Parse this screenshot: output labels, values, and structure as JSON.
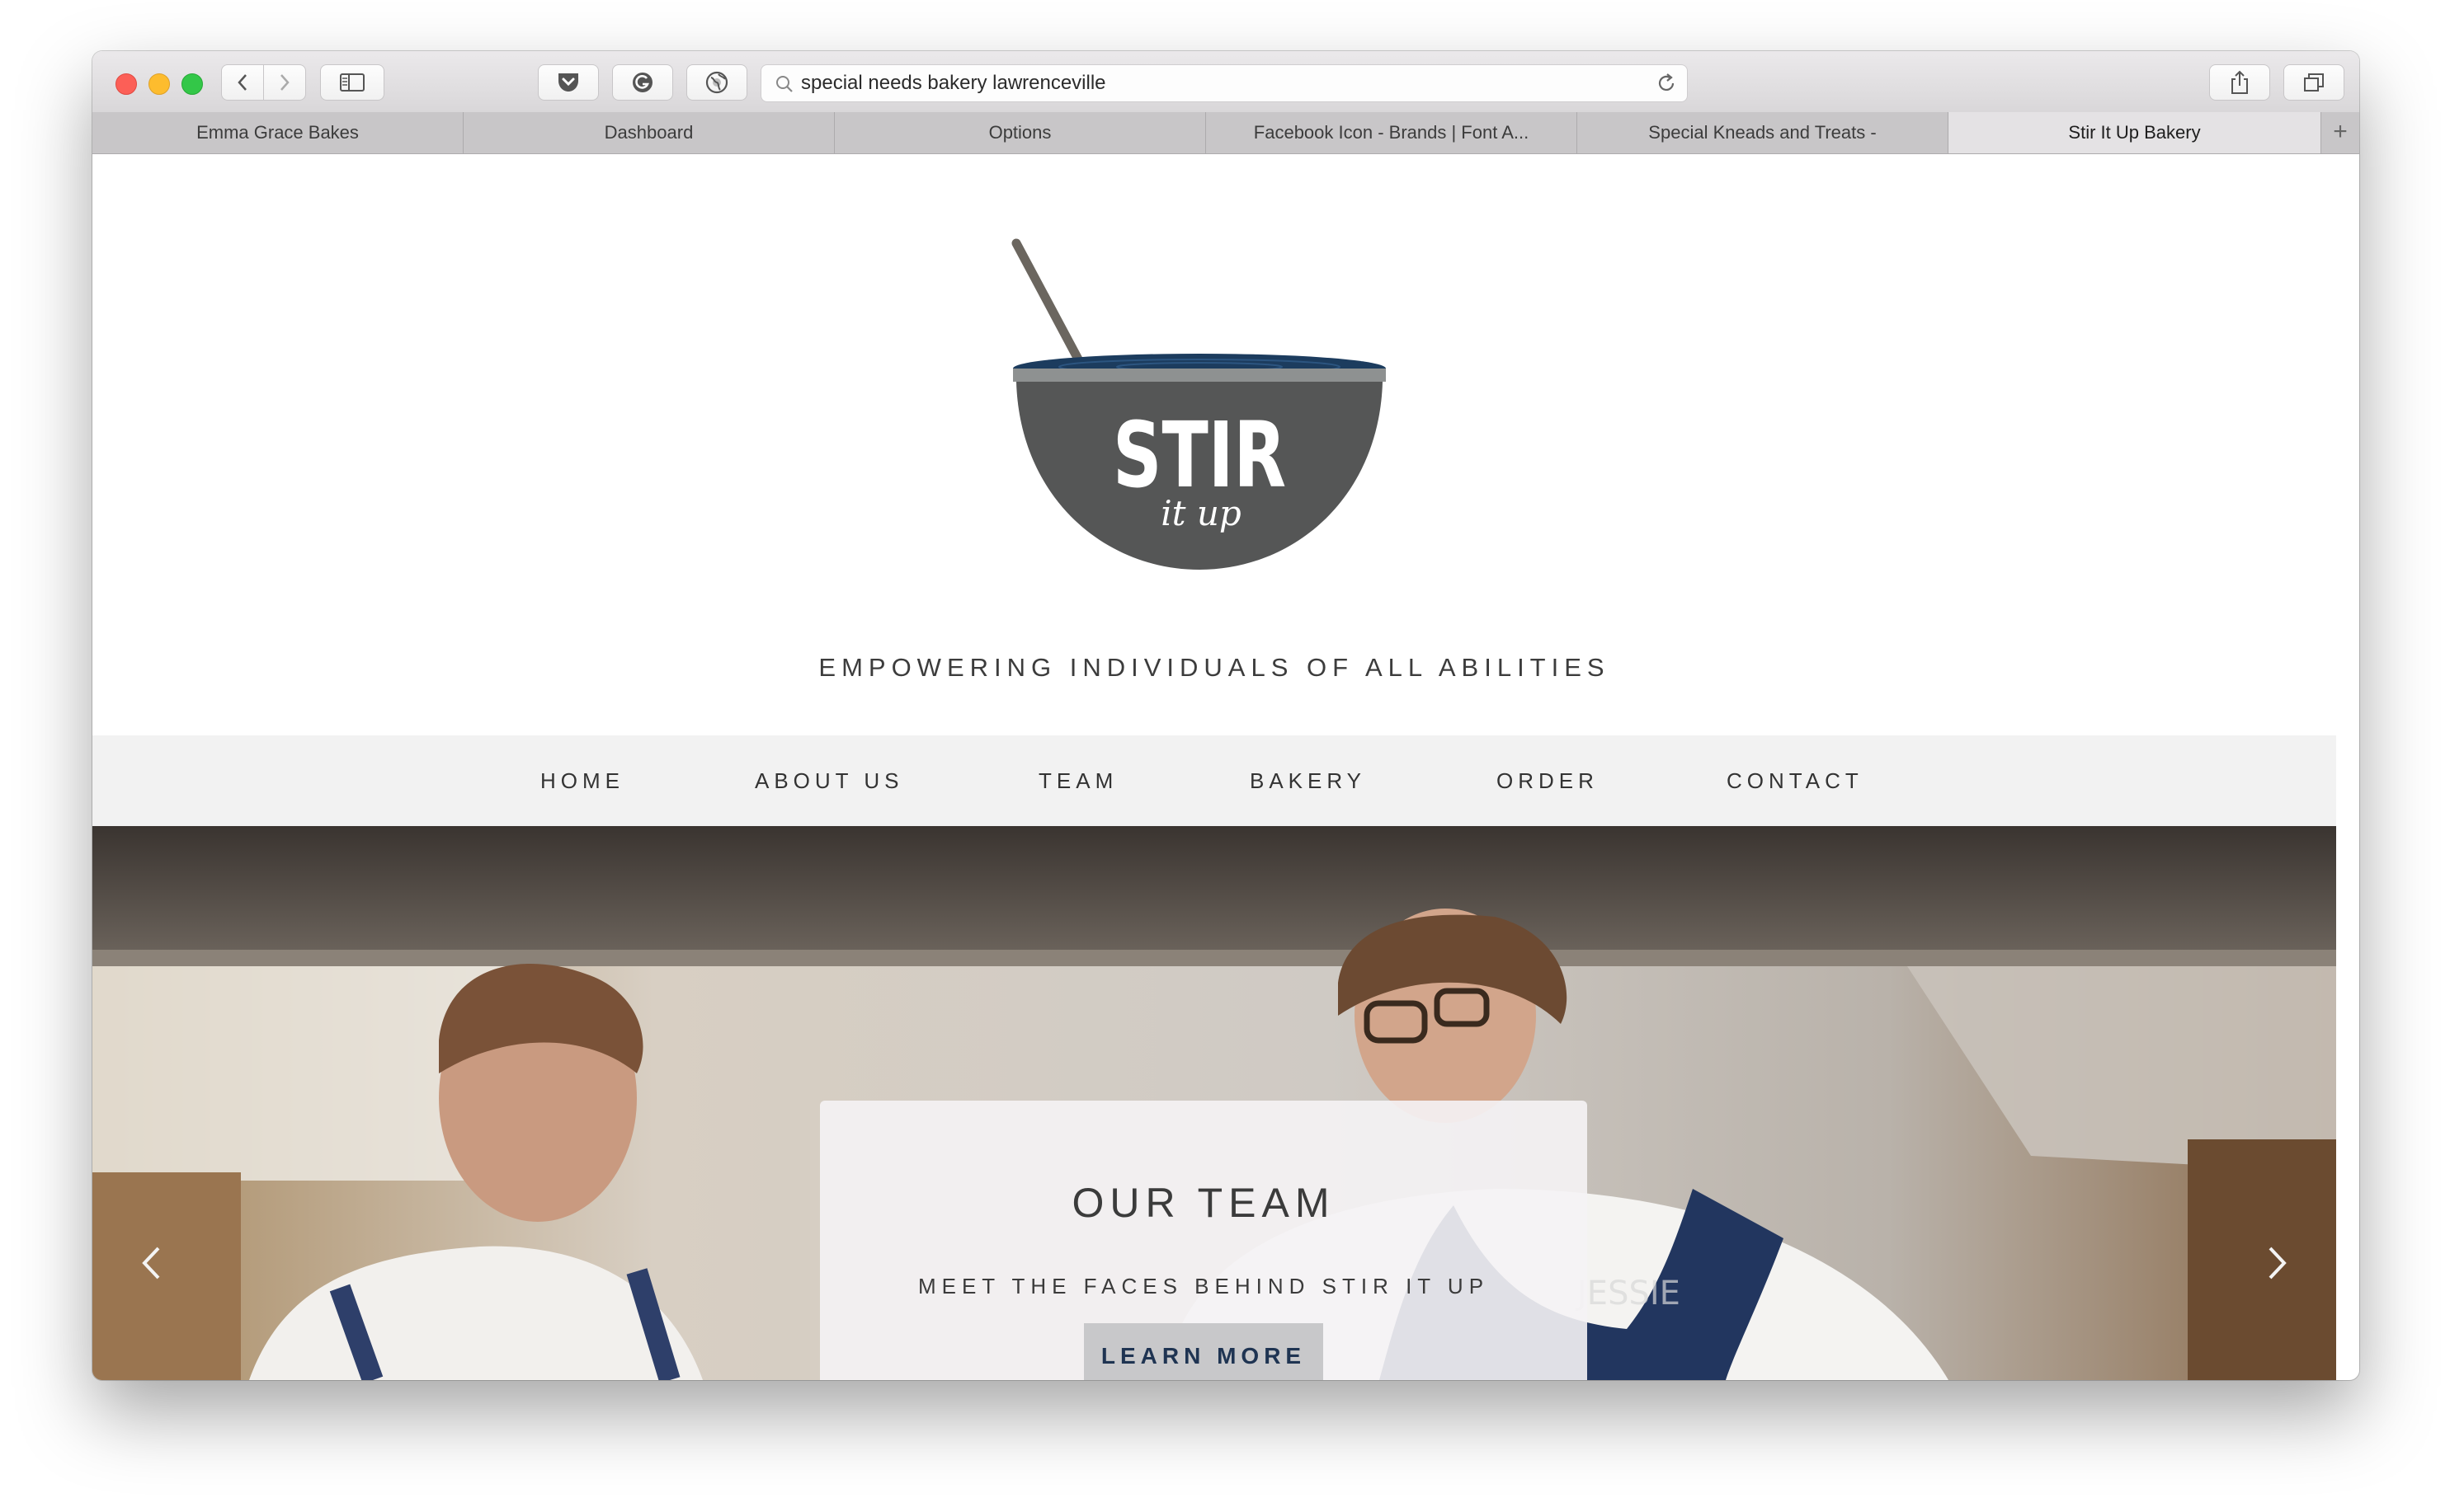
{
  "browser": {
    "url": "special needs bakery lawrenceville",
    "tabs": [
      {
        "label": "Emma Grace Bakes",
        "active": false
      },
      {
        "label": "Dashboard",
        "active": false
      },
      {
        "label": "Options",
        "active": false
      },
      {
        "label": "Facebook Icon - Brands | Font A...",
        "active": false
      },
      {
        "label": "Special Kneads and Treats -",
        "active": false
      },
      {
        "label": "Stir It Up Bakery",
        "active": true
      }
    ],
    "new_tab_label": "+"
  },
  "site": {
    "logo": {
      "word": "STIR",
      "script": "it up"
    },
    "tagline": "EMPOWERING INDIVIDUALS OF ALL ABILITIES",
    "nav": [
      "HOME",
      "ABOUT US",
      "TEAM",
      "BAKERY",
      "ORDER",
      "CONTACT"
    ],
    "hero": {
      "title": "OUR TEAM",
      "subtitle": "MEET THE FACES BEHIND STIR IT UP",
      "button": "LEARN MORE",
      "apron_name": "JESSIE"
    }
  },
  "colors": {
    "bowl": "#555656",
    "bowl_rim": "#1c3c5e",
    "button_text": "#1f3452",
    "nav_bg": "#f2f2f2"
  }
}
